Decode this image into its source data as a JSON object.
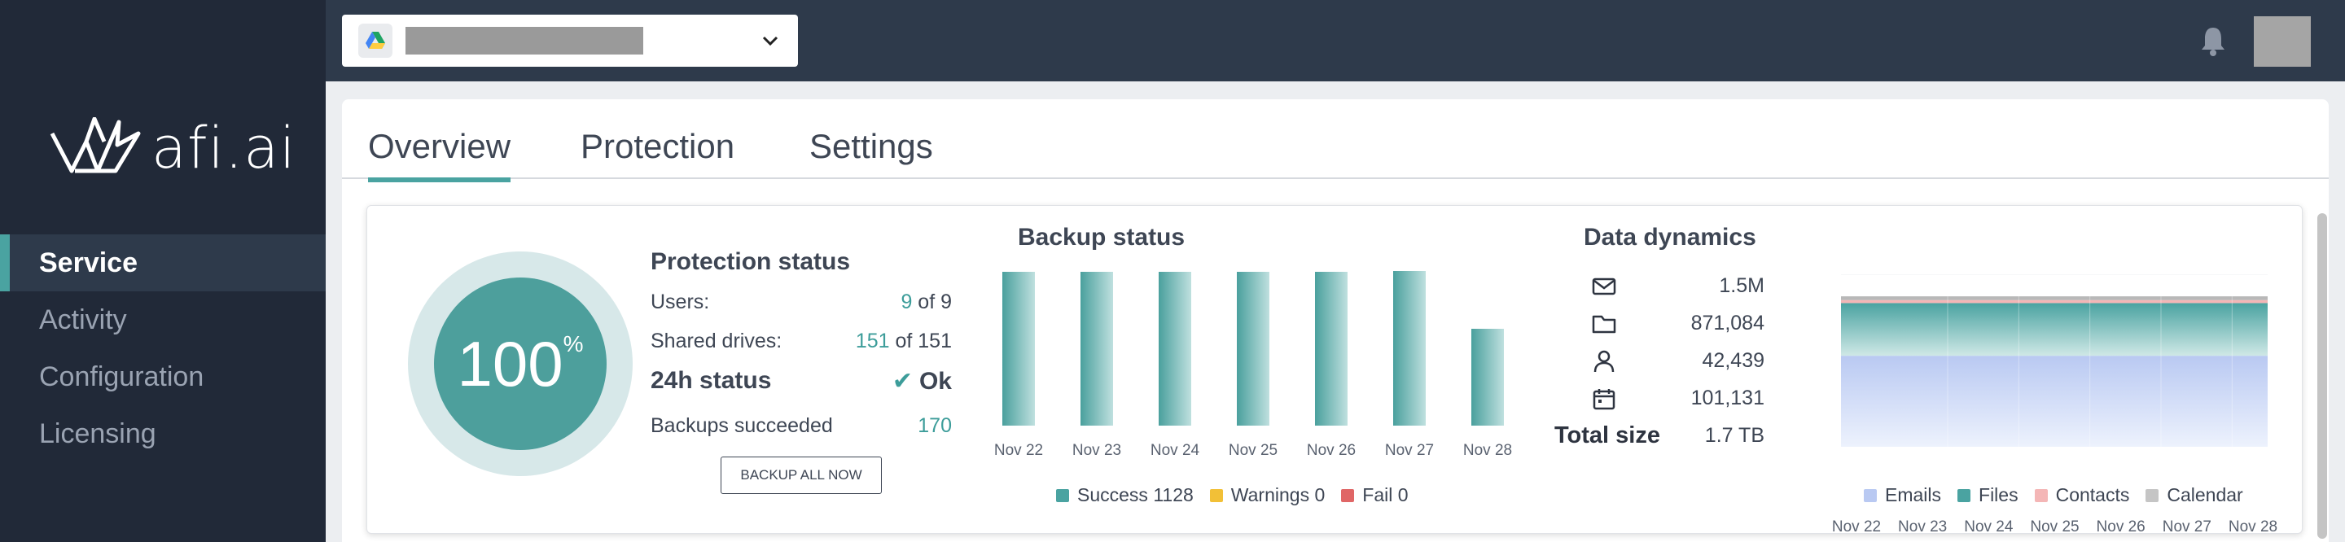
{
  "brand": {
    "logo_text": "afi.ai"
  },
  "sidebar": {
    "items": [
      {
        "label": "Service",
        "active": true
      },
      {
        "label": "Activity",
        "active": false
      },
      {
        "label": "Configuration",
        "active": false
      },
      {
        "label": "Licensing",
        "active": false
      }
    ]
  },
  "topbar": {
    "account_icon": "google-drive-icon",
    "account_name": "",
    "notifications_icon": "bell-icon"
  },
  "tabs": [
    {
      "label": "Overview",
      "active": true
    },
    {
      "label": "Protection",
      "active": false
    },
    {
      "label": "Settings",
      "active": false
    }
  ],
  "gauge": {
    "value": "100",
    "unit": "%"
  },
  "protection_status": {
    "title": "Protection status",
    "users_label": "Users:",
    "users_value": "9",
    "users_total": "of 9",
    "shared_drives_label": "Shared drives:",
    "shared_drives_value": "151",
    "shared_drives_total": "of 151",
    "status_label": "24h status",
    "status_value": "Ok",
    "backups_label": "Backups succeeded",
    "backups_value": "170",
    "backup_button": "BACKUP ALL NOW"
  },
  "backup_status": {
    "title": "Backup status",
    "legend": [
      {
        "label": "Success 1128",
        "color": "#4aa3a1"
      },
      {
        "label": "Warnings 0",
        "color": "#f2c037"
      },
      {
        "label": "Fail 0",
        "color": "#e06666"
      }
    ]
  },
  "data_dynamics": {
    "title": "Data dynamics",
    "rows": [
      {
        "icon": "envelope-icon",
        "value": "1.5M"
      },
      {
        "icon": "folder-icon",
        "value": "871,084"
      },
      {
        "icon": "person-icon",
        "value": "42,439"
      },
      {
        "icon": "calendar-icon",
        "value": "101,131"
      }
    ],
    "total_label": "Total size",
    "total_value": "1.7 TB",
    "legend": [
      {
        "label": "Emails",
        "color": "#b9c9f2"
      },
      {
        "label": "Files",
        "color": "#4aa3a1"
      },
      {
        "label": "Contacts",
        "color": "#f4b6b6"
      },
      {
        "label": "Calendar",
        "color": "#c5c5c5"
      }
    ]
  },
  "chart_data": [
    {
      "type": "bar",
      "title": "Backup status",
      "categories": [
        "Nov 22",
        "Nov 23",
        "Nov 24",
        "Nov 25",
        "Nov 26",
        "Nov 27",
        "Nov 28"
      ],
      "series": [
        {
          "name": "Success",
          "values": [
            170,
            170,
            170,
            170,
            170,
            171,
            107
          ]
        }
      ],
      "ylim": [
        0,
        171
      ],
      "grid": false,
      "legend": "bottom"
    },
    {
      "type": "area",
      "title": "Data dynamics",
      "categories": [
        "Nov 22",
        "Nov 23",
        "Nov 24",
        "Nov 25",
        "Nov 26",
        "Nov 27",
        "Nov 28"
      ],
      "series": [
        {
          "name": "Emails",
          "values": [
            0.95,
            0.95,
            0.95,
            0.95,
            0.95,
            0.95,
            0.95
          ]
        },
        {
          "name": "Files",
          "values": [
            0.55,
            0.55,
            0.55,
            0.55,
            0.55,
            0.55,
            0.55
          ]
        },
        {
          "name": "Contacts",
          "values": [
            0.03,
            0.03,
            0.03,
            0.03,
            0.03,
            0.03,
            0.03
          ]
        },
        {
          "name": "Calendar",
          "values": [
            0.04,
            0.04,
            0.04,
            0.04,
            0.04,
            0.04,
            0.04
          ]
        }
      ],
      "stacked": true,
      "unit": "TB",
      "ylim": [
        0,
        1.8
      ],
      "grid": true,
      "legend": "bottom"
    }
  ]
}
